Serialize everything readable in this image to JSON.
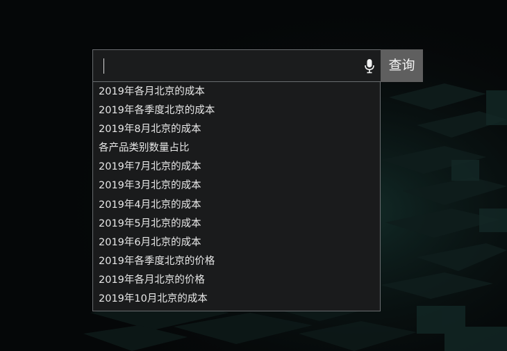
{
  "search": {
    "query": "",
    "voice_icon": "microphone-icon",
    "button_label": "查询"
  },
  "suggestions": [
    "2019年各月北京的成本",
    "2019年各季度北京的成本",
    "2019年8月北京的成本",
    "各产品类别数量占比",
    "2019年7月北京的成本",
    "2019年3月北京的成本",
    "2019年4月北京的成本",
    "2019年5月北京的成本",
    "2019年6月北京的成本",
    "2019年各季度北京的价格",
    "2019年各月北京的价格",
    "2019年10月北京的成本"
  ],
  "colors": {
    "background": "#050708",
    "panel": "#1a1b1c",
    "border": "#6a6d70",
    "button": "#5f5f5f",
    "text": "#e8e8e8"
  }
}
